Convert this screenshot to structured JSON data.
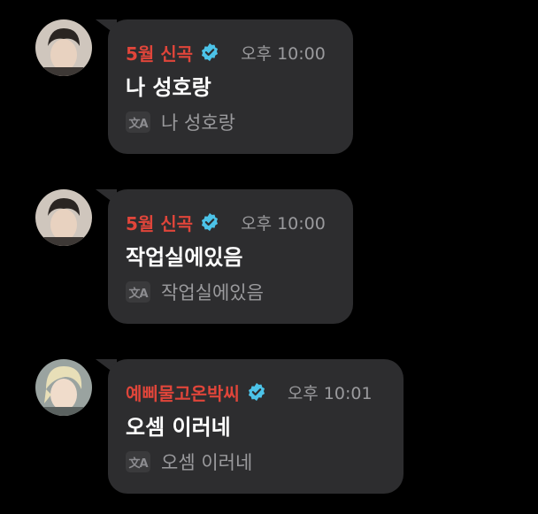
{
  "messages": [
    {
      "sender": "5월 신곡",
      "verified": true,
      "time": "오후 10:00",
      "text": "나 성호랑",
      "translation": "나 성호랑",
      "avatar": "dark-haired-person-avatar"
    },
    {
      "sender": "5월 신곡",
      "verified": true,
      "time": "오후 10:00",
      "text": "작업실에있음",
      "translation": "작업실에있음",
      "avatar": "dark-haired-person-avatar"
    },
    {
      "sender": "예삐물고온박씨",
      "verified": true,
      "time": "오후 10:01",
      "text": "오셈 이러네",
      "translation": "오셈 이러네",
      "avatar": "blonde-person-avatar"
    }
  ],
  "colors": {
    "background": "#000000",
    "bubble": "#2d2d2f",
    "sender": "#e0453a",
    "verified": "#4cc3e8",
    "time": "#9a9a9d",
    "text": "#ffffff"
  },
  "icons": {
    "translate": "translate-icon",
    "verified": "verified-badge-icon"
  }
}
